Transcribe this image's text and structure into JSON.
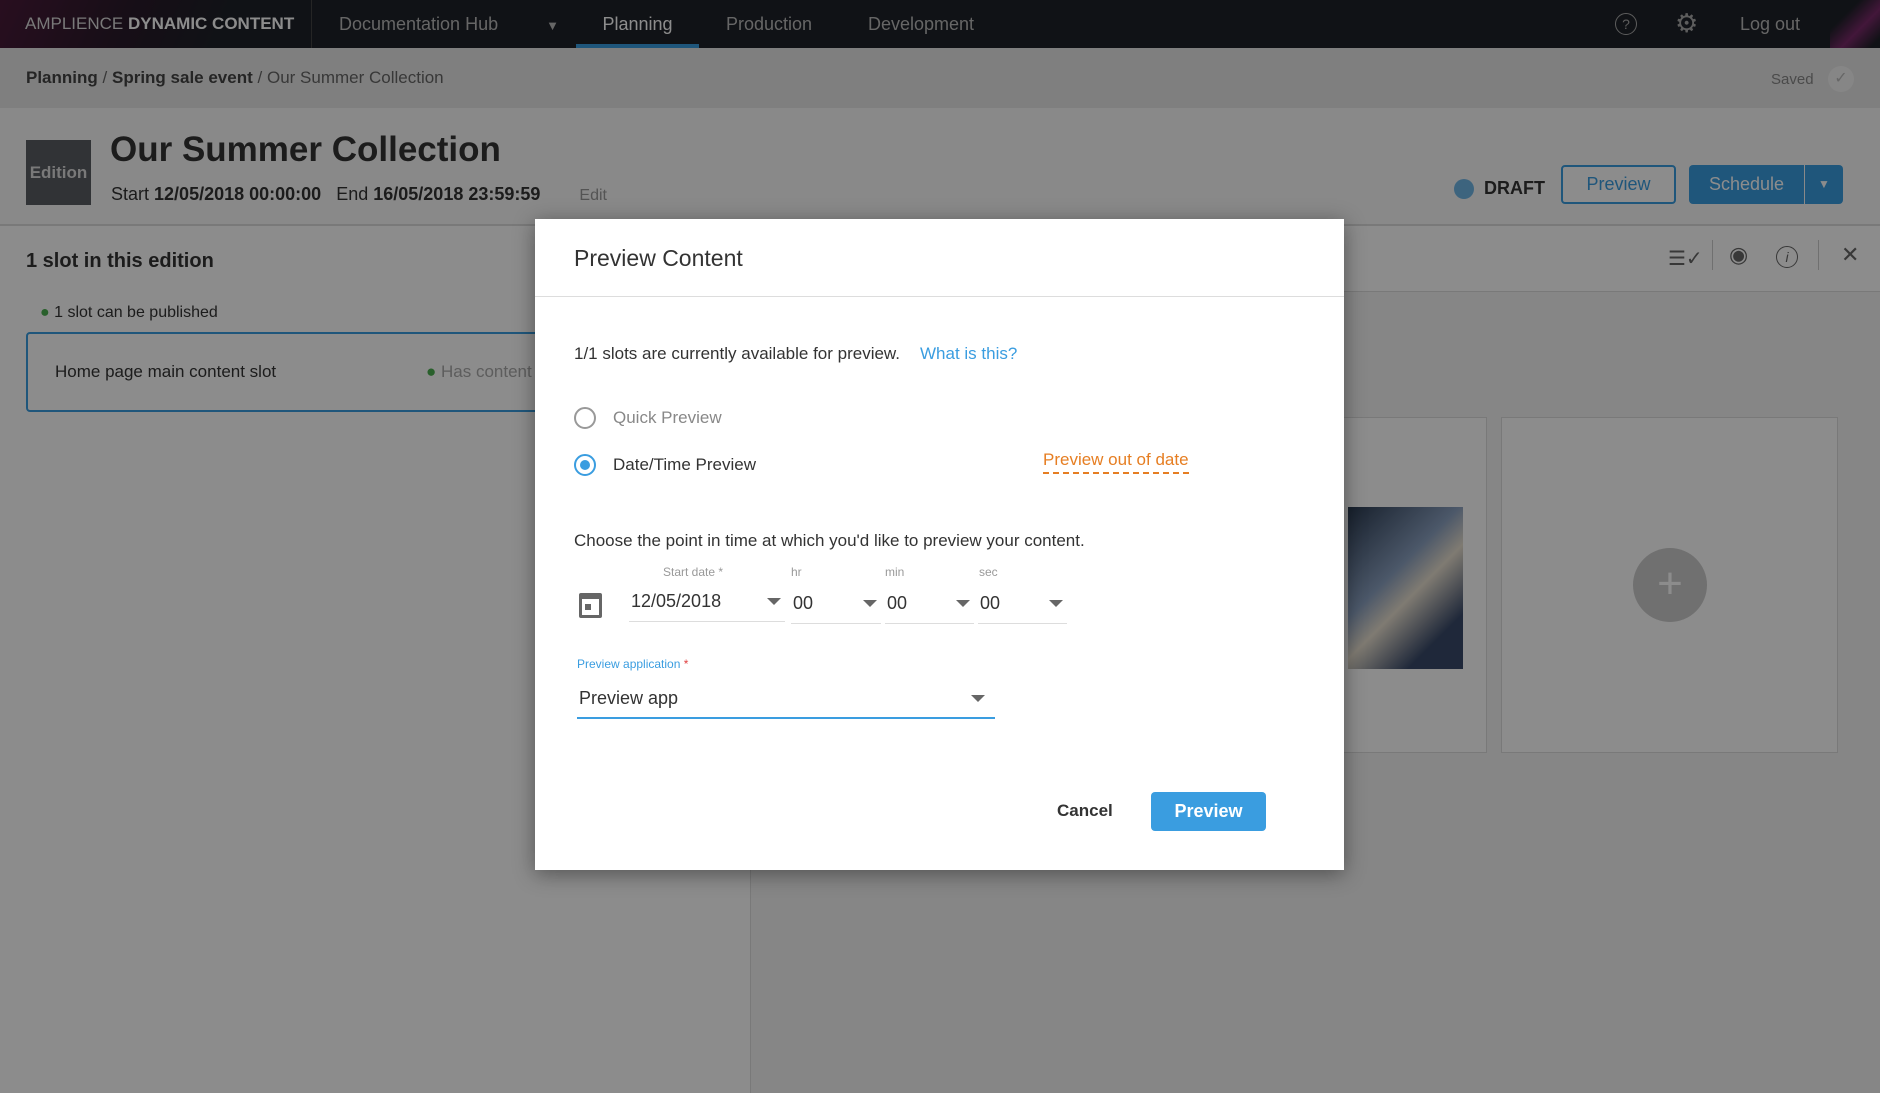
{
  "topbar": {
    "brand_light": "AMPLIENCE",
    "brand_bold": "DYNAMIC CONTENT",
    "hub": "Documentation Hub",
    "tabs": [
      "Planning",
      "Production",
      "Development"
    ],
    "active_tab": "Planning",
    "logout": "Log out"
  },
  "breadcrumb": {
    "items": [
      "Planning",
      "Spring sale event",
      "Our Summer Collection"
    ],
    "separator": "/",
    "saved": "Saved"
  },
  "header": {
    "badge": "Edition",
    "title": "Our Summer Collection",
    "start_label": "Start",
    "start": "12/05/2018 00:00:00",
    "end_label": "End",
    "end": "16/05/2018 23:59:59",
    "edit": "Edit",
    "status": "DRAFT",
    "preview": "Preview",
    "schedule": "Schedule"
  },
  "left": {
    "heading": "1 slot in this edition",
    "publishable": "1 slot can be published",
    "slot_name": "Home page main content slot",
    "slot_status": "Has content"
  },
  "modal": {
    "title": "Preview Content",
    "availability": "1/1 slots are currently available for preview.",
    "what_link": "What is this?",
    "options": [
      "Quick Preview",
      "Date/Time Preview"
    ],
    "selected": "Date/Time Preview",
    "out_of_date": "Preview out of date",
    "instruction": "Choose the point in time at which you'd like to preview your content.",
    "date_label": "Start date *",
    "date": "12/05/2018",
    "hr_label": "hr",
    "hr": "00",
    "min_label": "min",
    "min": "00",
    "sec_label": "sec",
    "sec": "00",
    "app_label": "Preview application",
    "app_required": "*",
    "app": "Preview app",
    "cancel": "Cancel",
    "preview": "Preview"
  },
  "colors": {
    "accent": "#3a9de0",
    "warning": "#e67e22",
    "success": "#4caf50",
    "topbar": "#1e2128"
  }
}
